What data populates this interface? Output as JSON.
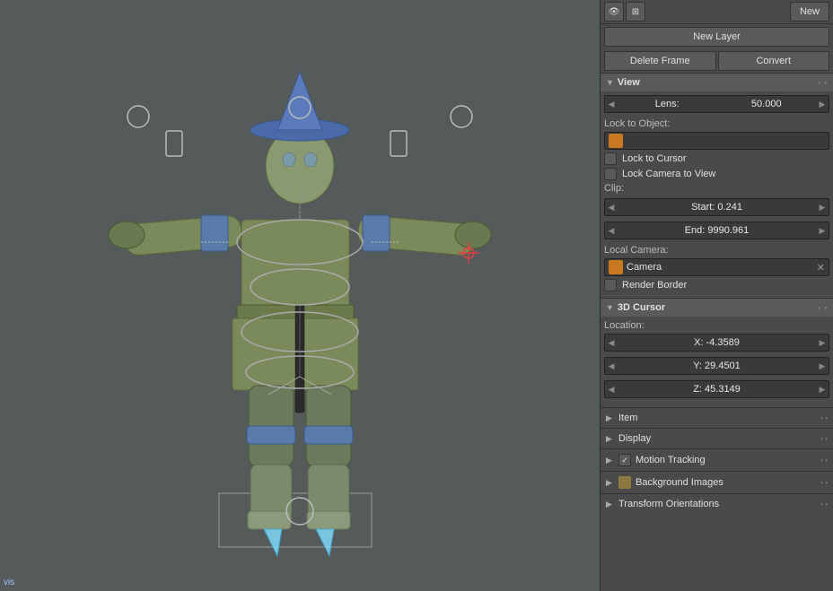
{
  "viewport": {
    "bg_color": "#555a5a",
    "bottom_label": "vis"
  },
  "toolbar": {
    "new_label": "New"
  },
  "panel": {
    "new_layer_label": "New Layer",
    "delete_frame_label": "Delete Frame",
    "convert_label": "Convert",
    "sections": {
      "view": {
        "title": "View",
        "lens_label": "Lens:",
        "lens_value": "50.000",
        "lock_to_object_label": "Lock to Object:",
        "lock_to_cursor_label": "Lock to Cursor",
        "lock_camera_label": "Lock Camera to View",
        "clip_label": "Clip:",
        "clip_start_label": "Start: 0.241",
        "clip_end_label": "End: 9990.961",
        "local_camera_label": "Local Camera:",
        "camera_value": "Camera",
        "render_border_label": "Render Border"
      },
      "cursor_3d": {
        "title": "3D Cursor",
        "location_label": "Location:",
        "x_value": "X: -4.3589",
        "y_value": "Y: 29.4501",
        "z_value": "Z: 45.3149"
      },
      "item": {
        "title": "Item"
      },
      "display": {
        "title": "Display"
      },
      "motion_tracking": {
        "title": "Motion Tracking",
        "icon": "checkbox"
      },
      "background_images": {
        "title": "Background Images",
        "icon": "image"
      },
      "transform_orientations": {
        "title": "Transform Orientations"
      }
    }
  }
}
